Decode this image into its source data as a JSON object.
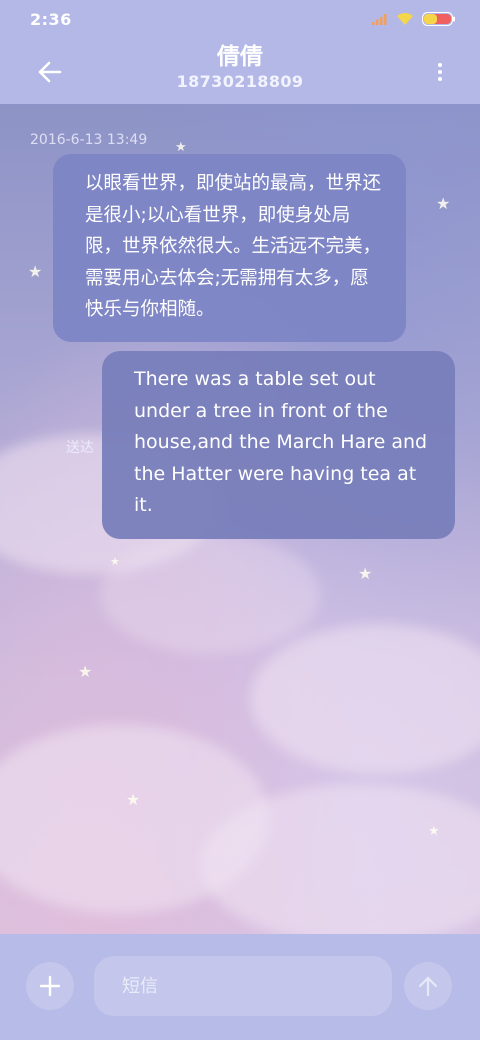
{
  "status_bar": {
    "time": "2:36",
    "icons": [
      "cellular-signal-icon",
      "wifi-icon",
      "battery-icon"
    ],
    "signal_color": "#f0a060",
    "wifi_color": "#f5d64a",
    "battery_color": "#f06060"
  },
  "header": {
    "contact_name": "倩倩",
    "contact_number": "18730218809",
    "back_icon": "back-arrow-icon",
    "more_icon": "more-vertical-icon"
  },
  "messages": [
    {
      "direction": "incoming",
      "timestamp": "2016-6-13 13:49",
      "text": "以眼看世界，即使站的最高，世界还是很小;以心看世界，即使身处局限，世界依然很大。生活远不完美，需要用心去体会;无需拥有太多，愿快乐与你相随。"
    },
    {
      "direction": "outgoing",
      "status": "送达",
      "text": "There was a table set out under a tree in front of the house,and the March Hare and the Hatter were having tea at it."
    }
  ],
  "composer": {
    "placeholder": "短信",
    "value": "",
    "add_icon": "plus-icon",
    "send_icon": "send-arrow-up-icon"
  },
  "colors": {
    "bar_background": "#b3b8e6",
    "incoming_bubble": "#7d84c4",
    "outgoing_bubble": "#787eba"
  }
}
